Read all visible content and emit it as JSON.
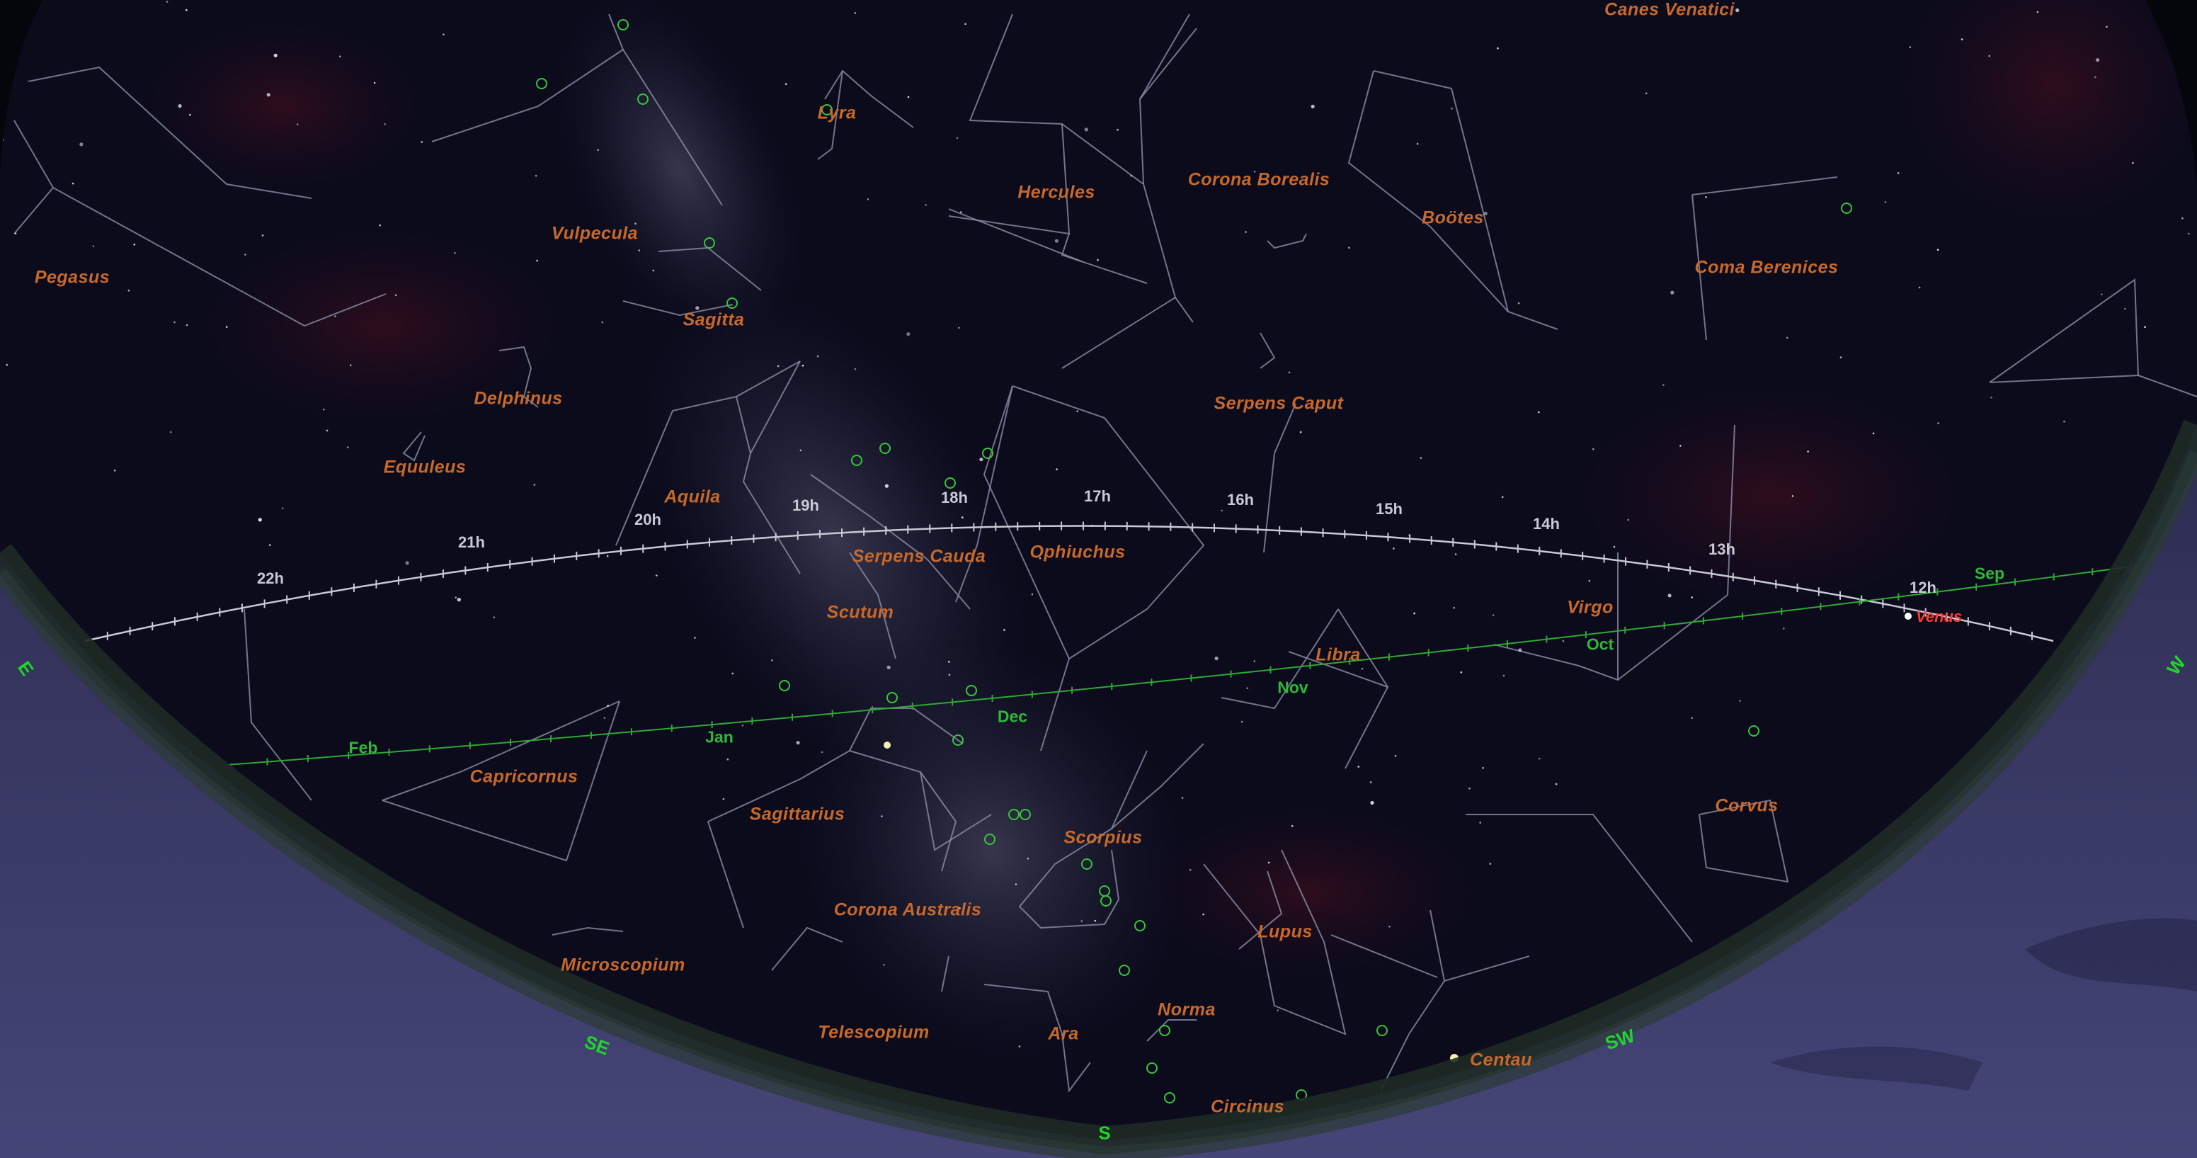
{
  "constellations": [
    "Canes Venatici",
    "Lyra",
    "Hercules",
    "Corona Borealis",
    "Boötes",
    "Coma Berenices",
    "Vulpecula",
    "Pegasus",
    "Sagitta",
    "Delphinus",
    "Equuleus",
    "Serpens Caput",
    "Aquila",
    "Ophiuchus",
    "Serpens Cauda",
    "Scutum",
    "Virgo",
    "Libra",
    "Capricornus",
    "Sagittarius",
    "Scorpius",
    "Corvus",
    "Corona Australis",
    "Lupus",
    "Microscopium",
    "Norma",
    "Telescopium",
    "Ara",
    "Circinus",
    "Centau"
  ],
  "ra_hours": [
    "22h",
    "21h",
    "20h",
    "19h",
    "18h",
    "17h",
    "16h",
    "15h",
    "14h",
    "13h",
    "12h"
  ],
  "ecliptic_months": [
    "Feb",
    "Jan",
    "Dec",
    "Nov",
    "Oct",
    "Sep"
  ],
  "planet": {
    "name": "Venus",
    "color": "#ff3a3a"
  },
  "cardinals": [
    "W",
    "SW",
    "S",
    "SE",
    "E"
  ],
  "colors": {
    "sky": "#0b0b1c",
    "label": "#c8682a",
    "ecliptic": "#2fa834",
    "equator": "#c9c9d6",
    "ground": "#37375f",
    "dso": "#38c53a"
  }
}
